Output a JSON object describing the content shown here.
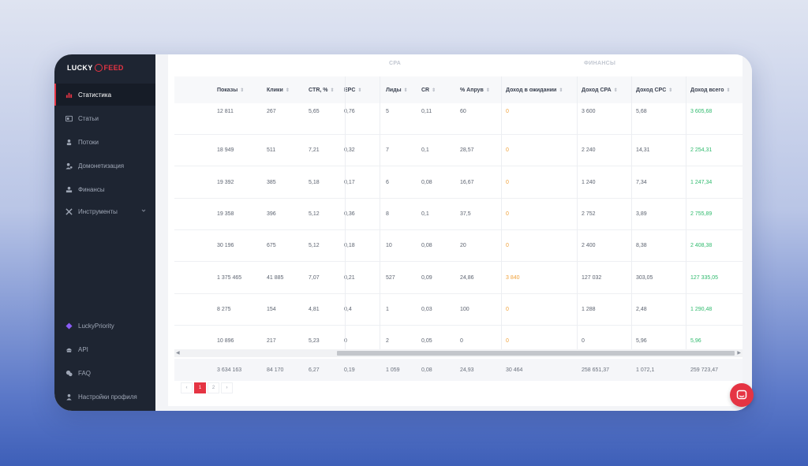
{
  "brand": {
    "part1": "LUCKY",
    "part2": "FEED"
  },
  "sidebar": {
    "items": [
      {
        "label": "Статистика",
        "icon": "bar-chart-icon",
        "active": true
      },
      {
        "label": "Статьи",
        "icon": "article-icon"
      },
      {
        "label": "Потоки",
        "icon": "flow-icon"
      },
      {
        "label": "Домонетизация",
        "icon": "user-coin-icon"
      },
      {
        "label": "Финансы",
        "icon": "finance-icon"
      },
      {
        "label": "Инструменты",
        "icon": "tools-icon",
        "has_submenu": true
      }
    ],
    "bottom": [
      {
        "label": "LuckyPriority",
        "icon": "diamond-icon"
      },
      {
        "label": "API",
        "icon": "api-icon"
      },
      {
        "label": "FAQ",
        "icon": "chat-icon"
      },
      {
        "label": "Настройки профиля",
        "icon": "profile-icon"
      }
    ]
  },
  "table": {
    "group_labels": {
      "cpa": "CPA",
      "finance": "ФИНАНСЫ"
    },
    "columns": [
      "Показы",
      "Клики",
      "CTR, %",
      "EPC",
      "Лиды",
      "CR",
      "% Апрув",
      "Доход в ожидании",
      "Доход CPA",
      "Доход CPC",
      "Доход всего"
    ],
    "rows": [
      [
        "12 811",
        "267",
        "5,65",
        "0,76",
        "5",
        "0,11",
        "60",
        "0",
        "3 600",
        "5,68",
        "3 605,68"
      ],
      [
        "18 949",
        "511",
        "7,21",
        "0,32",
        "7",
        "0,1",
        "28,57",
        "0",
        "2 240",
        "14,31",
        "2 254,31"
      ],
      [
        "19 392",
        "385",
        "5,18",
        "0,17",
        "6",
        "0,08",
        "16,67",
        "0",
        "1 240",
        "7,34",
        "1 247,34"
      ],
      [
        "19 358",
        "396",
        "5,12",
        "0,36",
        "8",
        "0,1",
        "37,5",
        "0",
        "2 752",
        "3,89",
        "2 755,89"
      ],
      [
        "30 196",
        "675",
        "5,12",
        "0,18",
        "10",
        "0,08",
        "20",
        "0",
        "2 400",
        "8,38",
        "2 408,38"
      ],
      [
        "1 375 465",
        "41 885",
        "7,07",
        "0,21",
        "527",
        "0,09",
        "24,86",
        "3 840",
        "127 032",
        "303,05",
        "127 335,05"
      ],
      [
        "8 275",
        "154",
        "4,81",
        "0,4",
        "1",
        "0,03",
        "100",
        "0",
        "1 288",
        "2,48",
        "1 290,48"
      ],
      [
        "10 896",
        "217",
        "5,23",
        "0",
        "2",
        "0,05",
        "0",
        "0",
        "0",
        "5,96",
        "5,96"
      ]
    ],
    "totals": [
      "3 634 163",
      "84 170",
      "6,27",
      "0,19",
      "1 059",
      "0,08",
      "24,93",
      "30 464",
      "258 651,37",
      "1 072,1",
      "259 723,47"
    ],
    "sort_glyph": "⇕",
    "colors": {
      "pending": "#f0a23b",
      "total_income": "#2fba6d",
      "accent": "#e53443"
    }
  },
  "pagination": {
    "prev": "‹",
    "pages": [
      "1",
      "2"
    ],
    "current": "1",
    "next": "›"
  }
}
